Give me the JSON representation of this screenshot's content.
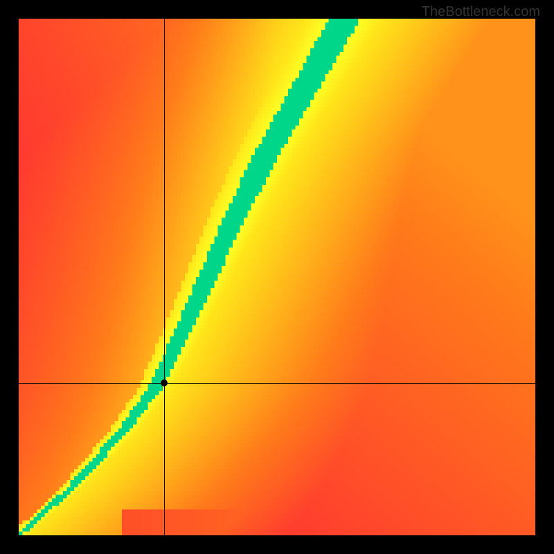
{
  "watermark": "TheBottleneck.com",
  "chart_data": {
    "type": "heatmap",
    "title": "",
    "xlabel": "",
    "ylabel": "",
    "xlim": [
      0,
      1
    ],
    "ylim": [
      0,
      1
    ],
    "resolution": 140,
    "crosshair": {
      "x": 0.282,
      "y": 0.295
    },
    "marker": {
      "x": 0.282,
      "y": 0.295
    },
    "optimal_path": {
      "description": "Narrow green band from lower-left to upper area, steepening after y~0.3; values near the band are optimal (green), far values are poor (red), yellow is transitional.",
      "control_points": [
        {
          "x": 0.0,
          "y": 0.0
        },
        {
          "x": 0.1,
          "y": 0.09
        },
        {
          "x": 0.2,
          "y": 0.2
        },
        {
          "x": 0.26,
          "y": 0.28
        },
        {
          "x": 0.3,
          "y": 0.36
        },
        {
          "x": 0.36,
          "y": 0.49
        },
        {
          "x": 0.42,
          "y": 0.62
        },
        {
          "x": 0.48,
          "y": 0.74
        },
        {
          "x": 0.55,
          "y": 0.86
        },
        {
          "x": 0.63,
          "y": 1.0
        }
      ]
    },
    "color_scale": [
      {
        "stop": 0.0,
        "color": "#ff1a3a"
      },
      {
        "stop": 0.4,
        "color": "#ff7a1a"
      },
      {
        "stop": 0.7,
        "color": "#ffe51a"
      },
      {
        "stop": 0.85,
        "color": "#fcff24"
      },
      {
        "stop": 1.0,
        "color": "#00d68a"
      }
    ]
  }
}
